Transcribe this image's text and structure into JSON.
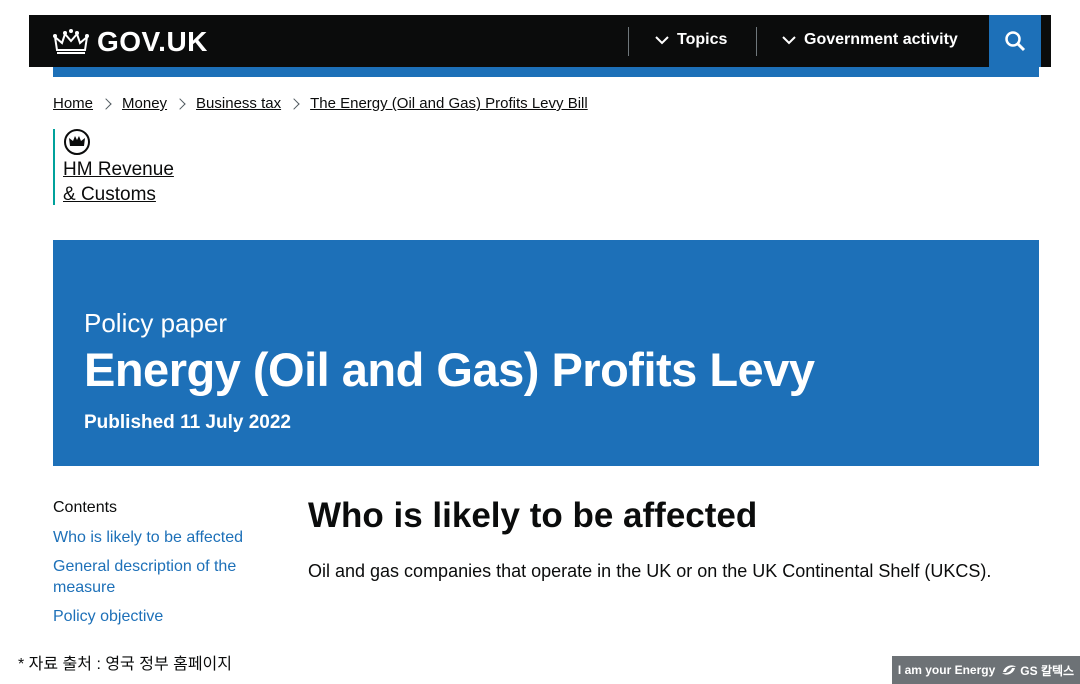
{
  "header": {
    "logo_text": "GOV.UK",
    "nav_topics": "Topics",
    "nav_government_activity": "Government activity",
    "search_icon": "search-icon"
  },
  "breadcrumbs": [
    "Home",
    "Money",
    "Business tax",
    "The Energy (Oil and Gas) Profits Levy Bill"
  ],
  "organisation": {
    "line1": "HM Revenue",
    "line2": "& Customs"
  },
  "banner": {
    "kind": "Policy paper",
    "title": "Energy (Oil and Gas) Profits Levy",
    "published": "Published 11 July 2022"
  },
  "contents": {
    "heading": "Contents",
    "links": [
      "Who is likely to be affected",
      "General description of the measure",
      "Policy objective"
    ]
  },
  "main": {
    "heading": "Who is likely to be affected",
    "paragraph": "Oil and gas companies that operate in the UK or on the UK Continental Shelf (UKCS)."
  },
  "footer": {
    "source_note": "* 자료 출처 : 영국 정부 홈페이지",
    "badge_text": "I am your Energy",
    "badge_brand": "GS 칼텍스"
  },
  "colors": {
    "header_bg": "#0b0c0c",
    "brand_blue": "#1d70b8",
    "hmrc_stripe": "#00a19b"
  }
}
